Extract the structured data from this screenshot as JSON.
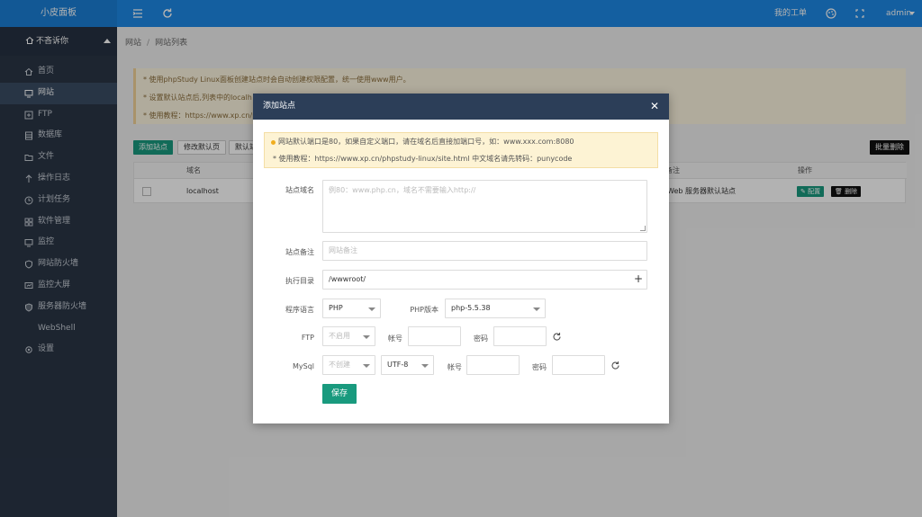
{
  "header": {
    "logo": "小皮面板",
    "my_tickets": "我的工单",
    "user": "admin",
    "icons": [
      "menu-fold-icon",
      "refresh-icon",
      "palette-icon",
      "fullscreen-icon"
    ]
  },
  "sidebar": {
    "user_name": "不吝诉你",
    "items": [
      {
        "label": "首页",
        "icon": "home-icon"
      },
      {
        "label": "网站",
        "icon": "monitor-icon"
      },
      {
        "label": "FTP",
        "icon": "ftp-icon"
      },
      {
        "label": "数据库",
        "icon": "database-icon"
      },
      {
        "label": "文件",
        "icon": "folder-icon"
      },
      {
        "label": "操作日志",
        "icon": "log-icon"
      },
      {
        "label": "计划任务",
        "icon": "clock-icon"
      },
      {
        "label": "软件管理",
        "icon": "grid-icon"
      },
      {
        "label": "监控",
        "icon": "monitor-icon"
      },
      {
        "label": "网站防火墙",
        "icon": "shield-icon"
      },
      {
        "label": "监控大屏",
        "icon": "screen-icon"
      },
      {
        "label": "服务器防火墙",
        "icon": "shield-icon"
      },
      {
        "label": "WebShell",
        "icon": "terminal-icon"
      },
      {
        "label": "设置",
        "icon": "gear-icon"
      }
    ],
    "active_index": 1
  },
  "breadcrumb": {
    "root": "网站",
    "current": "网站列表"
  },
  "notice": {
    "line1": "* 使用phpStudy Linux面板创建站点时会自动创建权限配置，统一使用www用户。",
    "line2": "* 设置默认站点后,列表中的localh",
    "line3": "* 使用教程：https://www.xp.cn/ph"
  },
  "toolbar": {
    "add_site": "添加站点",
    "edit_default_page": "修改默认页",
    "default_site": "默认站",
    "batch_delete": "批量删除"
  },
  "table": {
    "headers": {
      "domain": "域名",
      "note": "备注",
      "action": "操作"
    },
    "rows": [
      {
        "domain": "localhost",
        "note": "Web 服务器默认站点",
        "config": "配置",
        "delete": "删除"
      }
    ]
  },
  "modal": {
    "title": "添加站点",
    "notice_line1": "网站默认端口是80，如果自定义端口，请在域名后直接加端口号，如：www.xxx.com:8080",
    "notice_line2": "* 使用教程：https://www.xp.cn/phpstudy-linux/site.html   中文域名请先转码：punycode",
    "fields": {
      "domain_label": "站点域名",
      "domain_placeholder": "例80：www.php.cn，域名不需要输入http://",
      "note_label": "站点备注",
      "note_placeholder": "网站备注",
      "dir_label": "执行目录",
      "dir_value": "/wwwroot/",
      "lang_label": "程序语言",
      "lang_value": "PHP",
      "php_version_label": "PHP版本",
      "php_version_value": "php-5.5.38",
      "ftp_label": "FTP",
      "ftp_value": "不启用",
      "account_label": "帐号",
      "password_label": "密码",
      "mysql_label": "MySql",
      "mysql_value": "不创建",
      "charset_value": "UTF-8"
    },
    "save": "保存"
  }
}
